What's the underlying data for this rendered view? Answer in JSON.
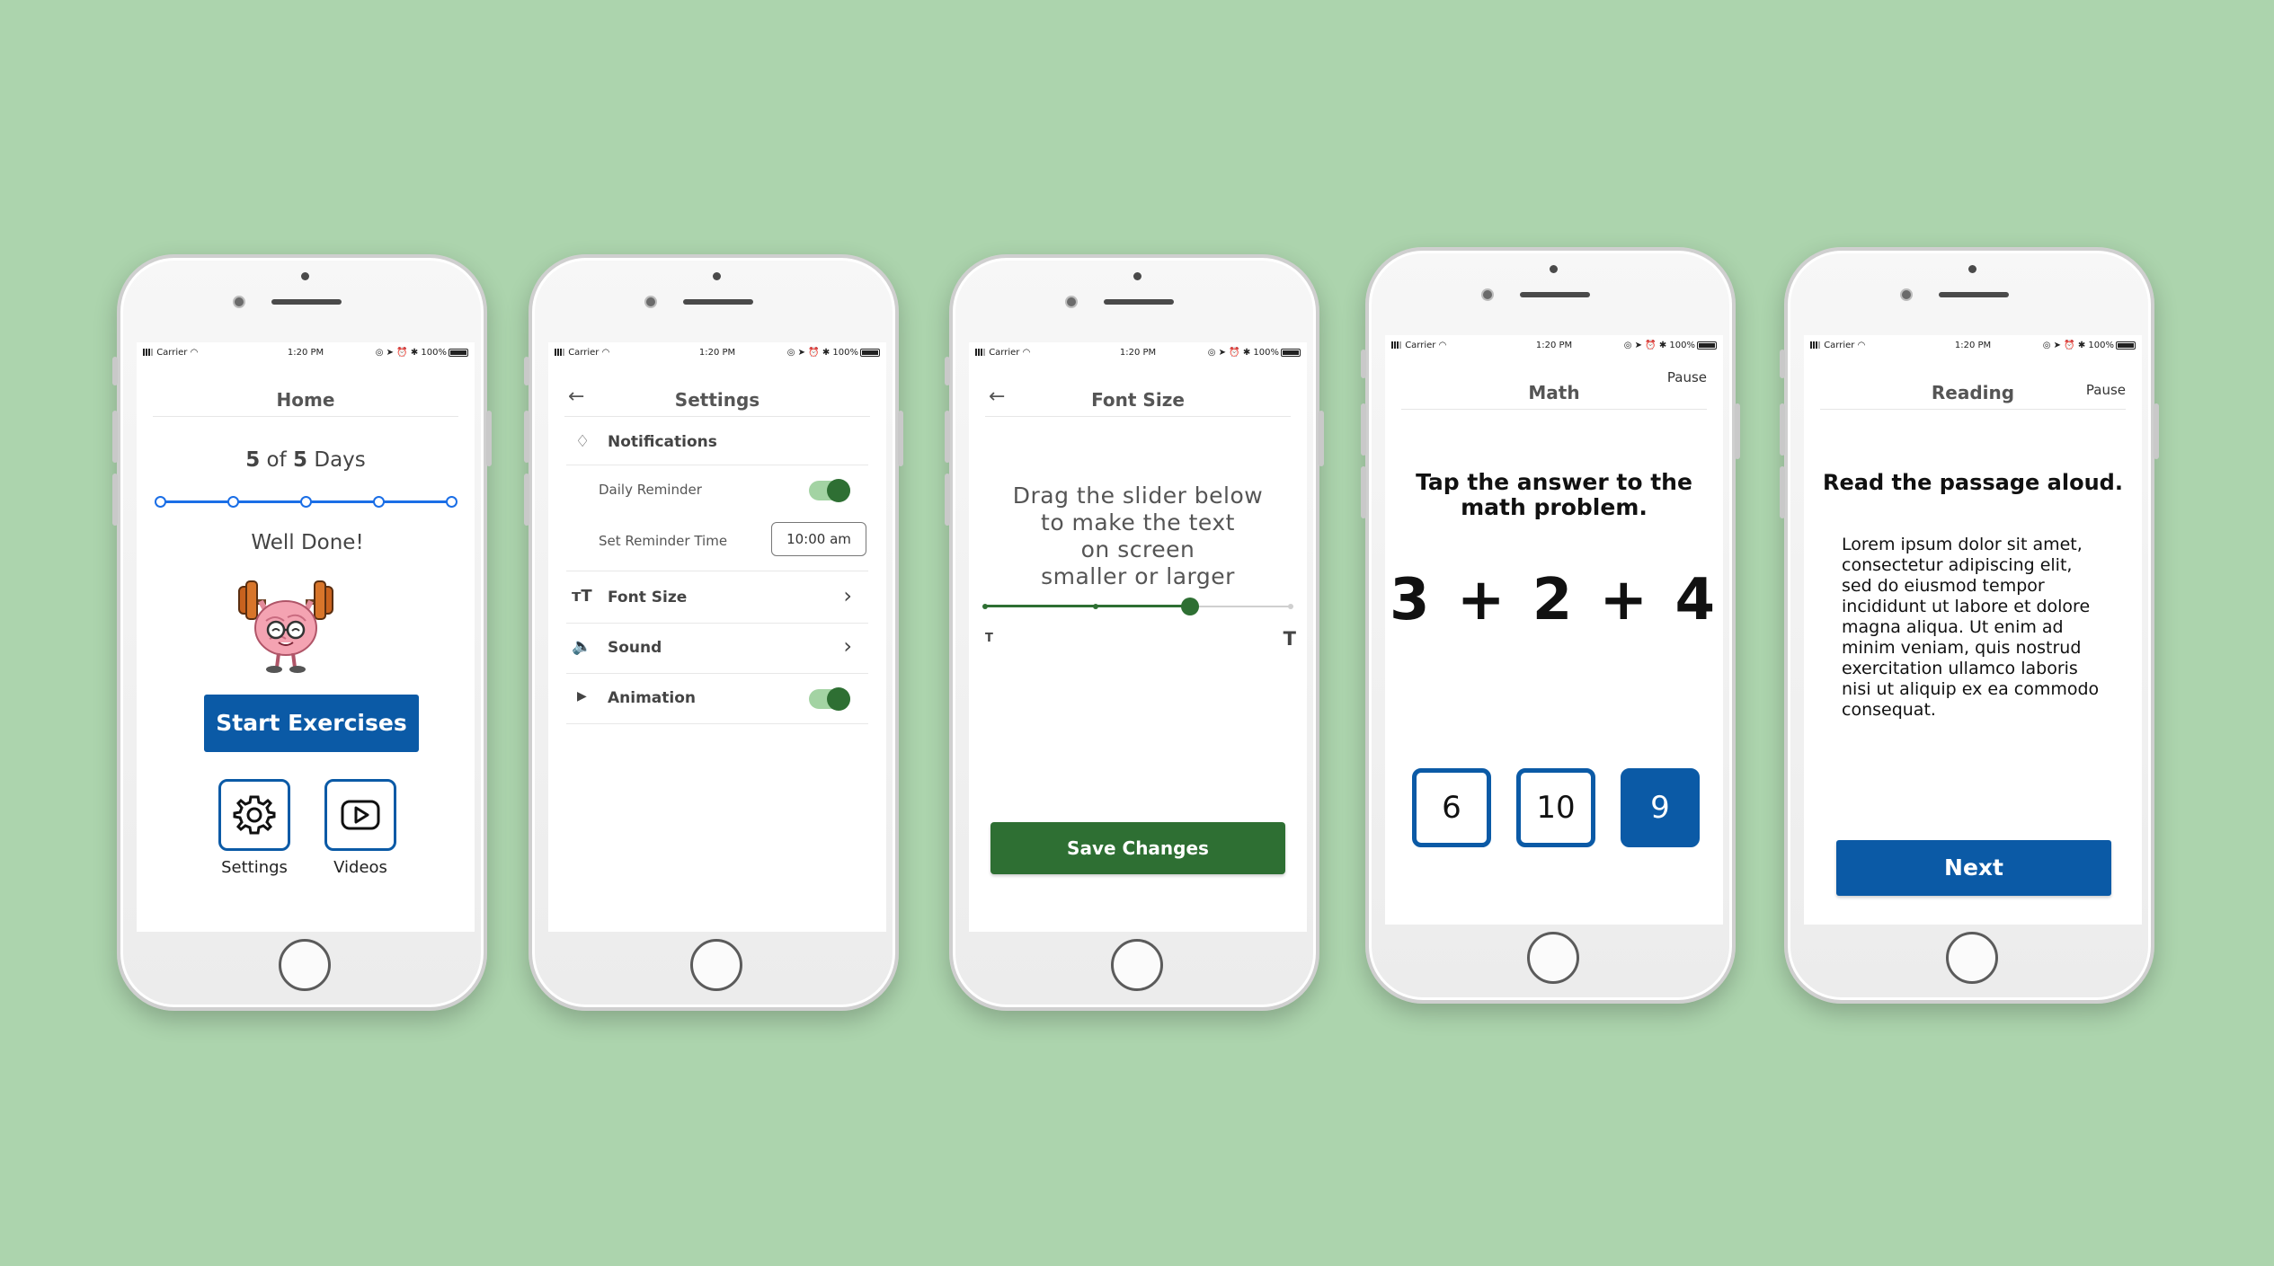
{
  "colors": {
    "background": "#acd4ad",
    "primary_blue": "#0b5aa6",
    "progress_blue": "#1a6ee6",
    "dark_green": "#2e6f33",
    "toggle_track": "#a3d3a3"
  },
  "status_bar": {
    "carrier": "Carrier",
    "time": "1:20 PM",
    "battery": "100%"
  },
  "home": {
    "title": "Home",
    "progress_current": "5",
    "progress_of": "of",
    "progress_total": "5",
    "progress_unit": "Days",
    "progress_fraction": 1.0,
    "message": "Well Done!",
    "mascot_icon": "brain-lifting-weights-icon",
    "start_button": "Start Exercises",
    "settings_label": "Settings",
    "videos_label": "Videos"
  },
  "settings": {
    "title": "Settings",
    "notifications": "Notifications",
    "daily_reminder": "Daily Reminder",
    "daily_reminder_on": true,
    "set_reminder_time": "Set Reminder Time",
    "reminder_time_value": "10:00 am",
    "font_size": "Font Size",
    "sound": "Sound",
    "animation": "Animation",
    "animation_on": true
  },
  "font_size": {
    "title": "Font Size",
    "instruction": [
      "Drag the slider below",
      "to make the text",
      "on screen",
      "smaller or larger"
    ],
    "small_label": "T",
    "large_label": "T",
    "slider_level": 0.67,
    "save_button": "Save Changes"
  },
  "math": {
    "title": "Math",
    "pause": "Pause",
    "instruction": [
      "Tap the answer to the",
      "math problem."
    ],
    "problem": "3 + 2 + 4",
    "answers": [
      "6",
      "10",
      "9"
    ],
    "selected_answer": "9"
  },
  "reading": {
    "title": "Reading",
    "pause": "Pause",
    "instruction": "Read the passage aloud.",
    "passage": [
      "Lorem ipsum dolor sit amet,",
      "consectetur adipiscing elit,",
      "sed do eiusmod tempor",
      "incididunt ut labore et dolore",
      "magna aliqua. Ut enim ad",
      "minim veniam, quis nostrud",
      "exercitation ullamco laboris",
      "nisi ut aliquip ex ea commodo",
      "consequat."
    ],
    "next_button": "Next"
  }
}
